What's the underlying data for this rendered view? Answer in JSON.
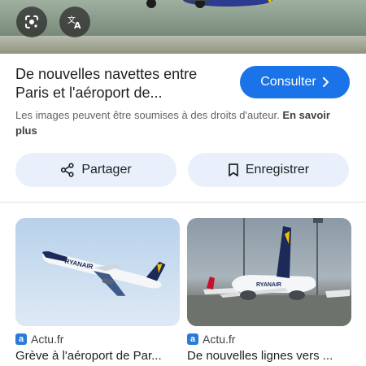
{
  "hero": {
    "lens_icon": "google-lens-icon",
    "translate_icon": "translate-icon"
  },
  "result": {
    "title_line1": "De nouvelles navettes entre",
    "title_line2": "Paris et l'aéroport de...",
    "consult_label": "Consulter",
    "copyright_text": "Les images peuvent être soumises à des droits d'auteur.",
    "learn_more": "En savoir plus"
  },
  "actions": {
    "share_label": "Partager",
    "save_label": "Enregistrer"
  },
  "related": [
    {
      "source": "Actu.fr",
      "title": "Grève à l'aéroport de Par..."
    },
    {
      "source": "Actu.fr",
      "title": "De nouvelles lignes vers ..."
    }
  ],
  "colors": {
    "accent": "#1a73e8",
    "pill_bg": "#e9f0fb"
  }
}
